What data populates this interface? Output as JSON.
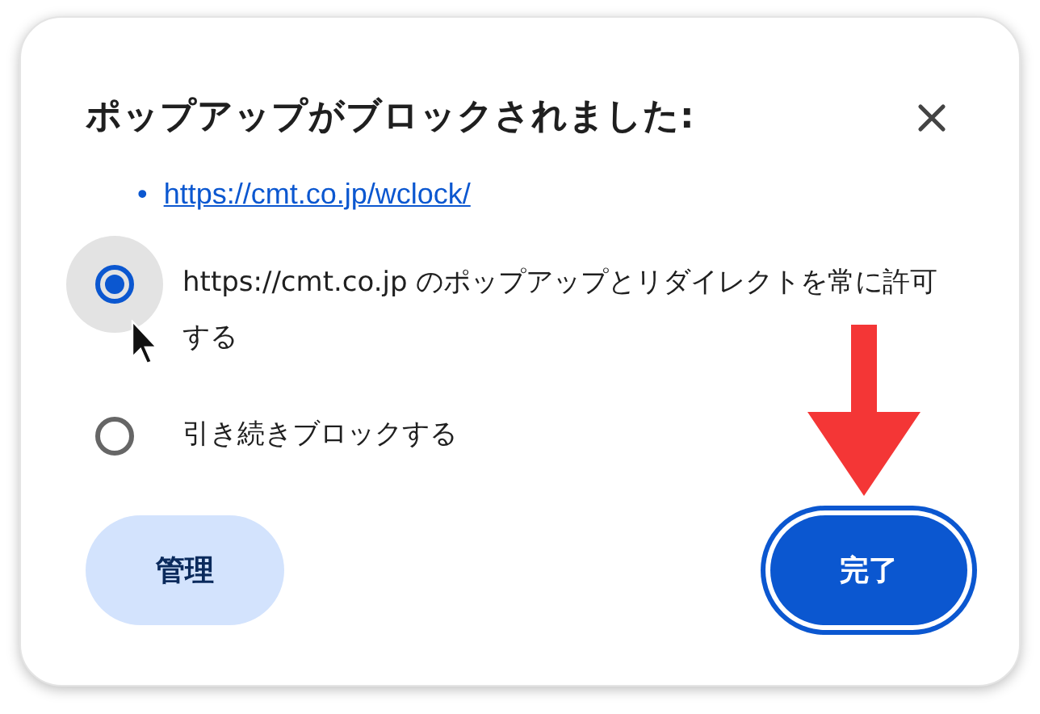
{
  "dialog": {
    "title": "ポップアップがブロックされました:",
    "links": [
      {
        "bullet": "•",
        "url": "https://cmt.co.jp/wclock/"
      }
    ],
    "options": [
      {
        "label": "https://cmt.co.jp のポップアップとリダイレクトを常に許可する",
        "selected": true,
        "hovered": true
      },
      {
        "label": "引き続きブロックする",
        "selected": false,
        "hovered": false
      }
    ],
    "buttons": [
      {
        "label": "管理",
        "kind": "secondary",
        "focused": false
      },
      {
        "label": "完了",
        "kind": "primary",
        "focused": true
      }
    ]
  }
}
